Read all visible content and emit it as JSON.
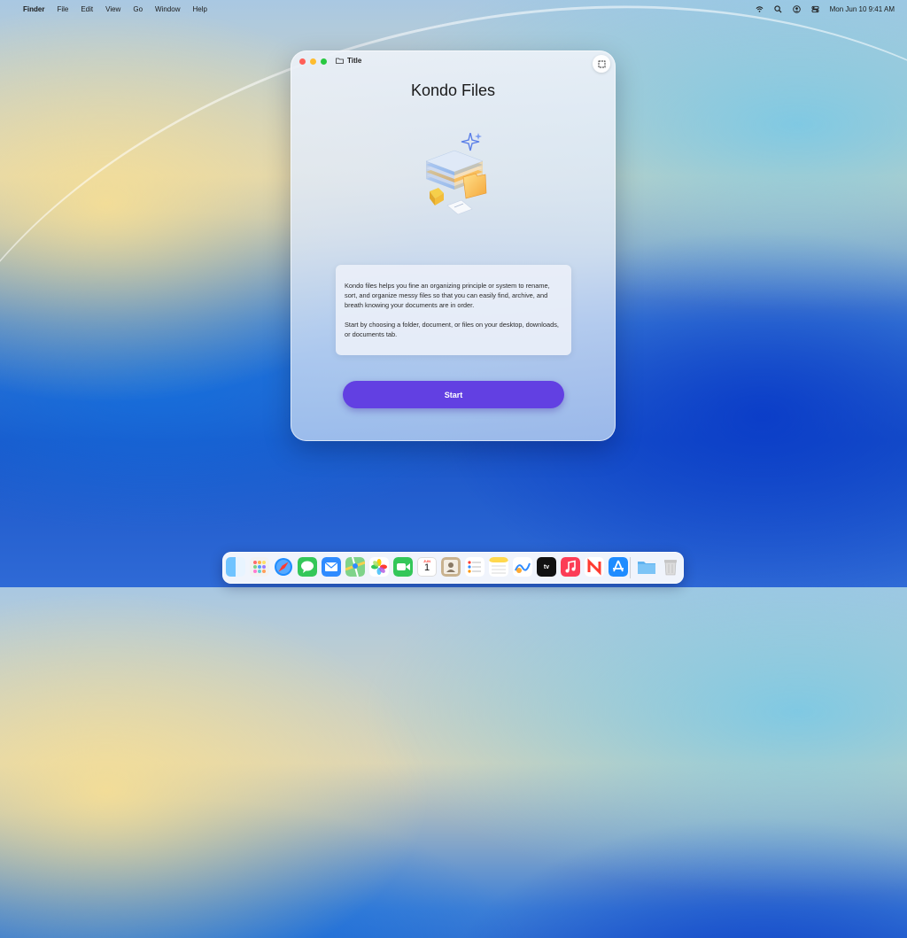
{
  "menubar": {
    "apple": "",
    "app": "Finder",
    "menus": [
      "File",
      "Edit",
      "View",
      "Go",
      "Window",
      "Help"
    ],
    "datetime": "Mon Jun 10  9:41 AM",
    "status_icons": [
      "wifi-icon",
      "spotlight-icon",
      "user-icon",
      "control-center-icon"
    ]
  },
  "window": {
    "title": "Title",
    "title_icon": "folder-icon",
    "expand_icon": "fullscreen-icon",
    "headline": "Kondo Files",
    "description_1": "Kondo files helps you fine an organizing principle or system to rename, sort, and organize messy files so that you can easily find, archive, and breath knowing your documents are in order.",
    "description_2": "Start by choosing a folder, document, or files on your desktop, downloads, or documents tab.",
    "start_label": "Start",
    "accent": "#6240e2"
  },
  "dock": {
    "apps": [
      "Finder",
      "Launchpad",
      "Safari",
      "Messages",
      "Mail",
      "Maps",
      "Photos",
      "FaceTime",
      "Calendar",
      "Contacts",
      "Reminders",
      "Notes",
      "Freeform",
      "TV",
      "Music",
      "News",
      "App Store",
      "Downloads",
      "Trash"
    ],
    "calendar_month": "JUN",
    "calendar_day": "1",
    "tv_label": "tv"
  }
}
